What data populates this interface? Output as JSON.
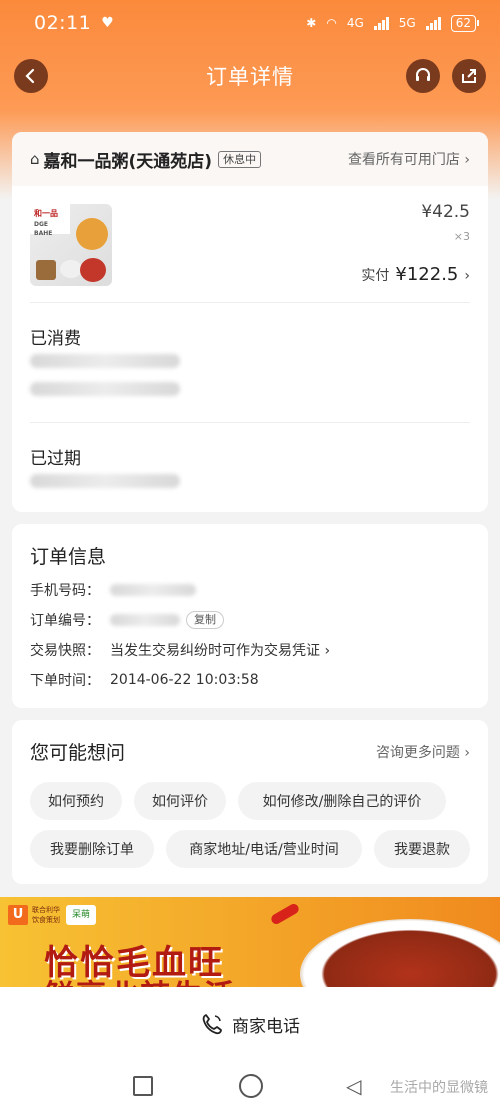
{
  "status_bar": {
    "time": "02:11",
    "battery": "62",
    "net1": "4G",
    "net2": "5G"
  },
  "navbar": {
    "title": "订单详情"
  },
  "store": {
    "name": "嘉和一品粥(天通苑店)",
    "status_tag": "休息中",
    "all_stores_link": "查看所有可用门店 ›"
  },
  "order_item": {
    "unit_price": "¥42.5",
    "quantity": "×3",
    "paid_label": "实付",
    "paid_amount": "¥122.5",
    "thumb_brand": "和一品",
    "thumb_sub": "DGE BAHE"
  },
  "sections": {
    "consumed": "已消费",
    "expired": "已过期"
  },
  "order_info": {
    "title": "订单信息",
    "phone_label": "手机号码：",
    "order_no_label": "订单编号：",
    "copy_label": "复制",
    "snapshot_label": "交易快照：",
    "snapshot_value": "当发生交易纠纷时可作为交易凭证 ›",
    "order_time_label": "下单时间：",
    "order_time_value": "2014-06-22 10:03:58"
  },
  "faq": {
    "title": "您可能想问",
    "more_link": "咨询更多问题 ›",
    "chips": [
      "如何预约",
      "如何评价",
      "如何修改/删除自己的评价",
      "我要删除订单",
      "商家地址/电话/营业时间",
      "我要退款"
    ]
  },
  "banner": {
    "brand_text": "联合利华饮食策划",
    "partner": "呆萌",
    "slogan_line1": "恰恰毛血旺",
    "slogan_line2": "鲜享北辣生活"
  },
  "call_bar": {
    "label": "商家电话"
  },
  "watermark": "生活中的显微镜"
}
